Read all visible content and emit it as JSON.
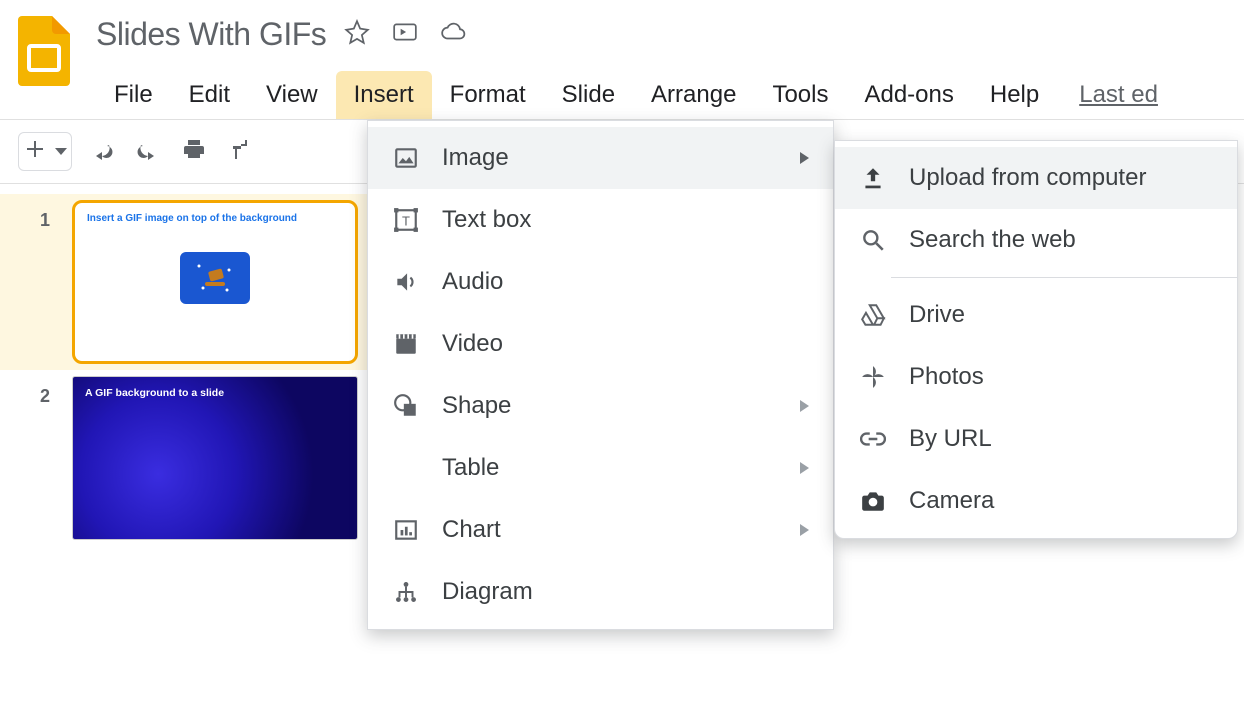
{
  "doc": {
    "title": "Slides With GIFs"
  },
  "menu": {
    "file": "File",
    "edit": "Edit",
    "view": "View",
    "insert": "Insert",
    "format": "Format",
    "slide": "Slide",
    "arrange": "Arrange",
    "tools": "Tools",
    "addons": "Add-ons",
    "help": "Help",
    "last_edit": "Last ed"
  },
  "thumbnails": {
    "slide1": {
      "number": "1",
      "caption": "Insert a GIF image on top of the background"
    },
    "slide2": {
      "number": "2",
      "caption": "A GIF background to a slide"
    }
  },
  "insert_menu": {
    "image": "Image",
    "textbox": "Text box",
    "audio": "Audio",
    "video": "Video",
    "shape": "Shape",
    "table": "Table",
    "chart": "Chart",
    "diagram": "Diagram"
  },
  "image_submenu": {
    "upload": "Upload from computer",
    "search": "Search the web",
    "drive": "Drive",
    "photos": "Photos",
    "url": "By URL",
    "camera": "Camera"
  }
}
